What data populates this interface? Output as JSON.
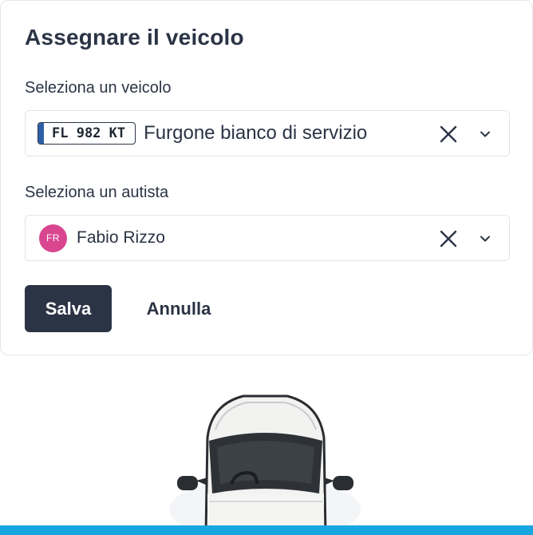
{
  "dialog": {
    "title": "Assegnare il veicolo",
    "vehicle": {
      "label": "Seleziona un veicolo",
      "plate": "FL 982 KT",
      "value": "Furgone bianco di servizio"
    },
    "driver": {
      "label": "Seleziona un autista",
      "initials": "FR",
      "value": "Fabio Rizzo",
      "avatar_color": "#d9468f"
    },
    "buttons": {
      "save": "Salva",
      "cancel": "Annulla"
    }
  },
  "colors": {
    "primary": "#2b3445",
    "accent_bar": "#18a6e0",
    "plate_band": "#2f5fa8"
  },
  "icons": [
    "close-icon",
    "chevron-down-icon",
    "car-illustration"
  ]
}
